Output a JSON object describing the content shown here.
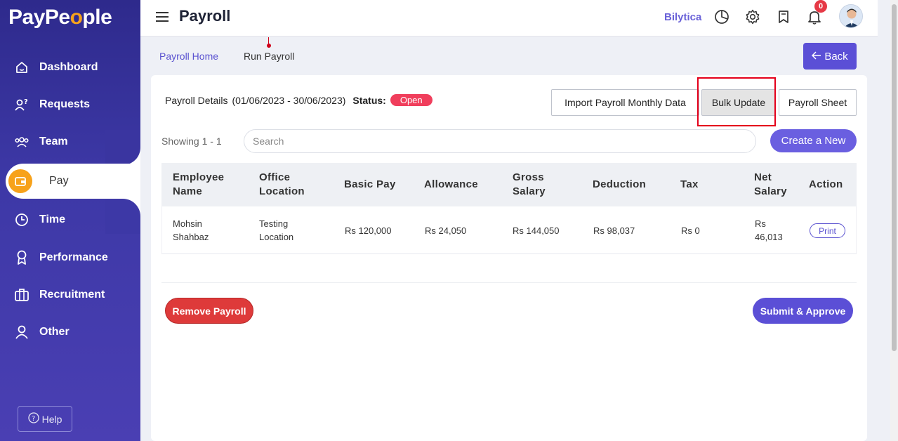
{
  "app": {
    "logo_pre": "PayPe",
    "logo_o": "o",
    "logo_post": "ple"
  },
  "sidebar": {
    "items": [
      {
        "label": "Dashboard",
        "icon": "home-icon"
      },
      {
        "label": "Requests",
        "icon": "requests-icon"
      },
      {
        "label": "Team",
        "icon": "team-icon"
      },
      {
        "label": "Pay",
        "icon": "wallet-icon",
        "active": true
      },
      {
        "label": "Time",
        "icon": "clock-icon"
      },
      {
        "label": "Performance",
        "icon": "award-icon"
      },
      {
        "label": "Recruitment",
        "icon": "briefcase-icon"
      },
      {
        "label": "Other",
        "icon": "user-icon"
      }
    ],
    "help_label": "Help"
  },
  "header": {
    "title": "Payroll",
    "company": "Bilytica",
    "notification_count": "0"
  },
  "breadcrumb": {
    "home": "Payroll Home",
    "current": "Run Payroll"
  },
  "back_label": "Back",
  "details": {
    "label": "Payroll Details",
    "period": "(01/06/2023 - 30/06/2023)",
    "status_label": "Status:",
    "status_value": "Open"
  },
  "actions": {
    "import": "Import Payroll Monthly Data",
    "bulk_update": "Bulk Update",
    "payroll_sheet": "Payroll Sheet",
    "create_new": "Create a New",
    "remove": "Remove Payroll",
    "submit": "Submit & Approve"
  },
  "listing": {
    "showing": "Showing 1 - 1",
    "search_placeholder": "Search"
  },
  "table": {
    "headers": {
      "employee_1": "Employee",
      "employee_2": "Name",
      "office_1": "Office",
      "office_2": "Location",
      "basic": "Basic Pay",
      "allowance": "Allowance",
      "gross_1": "Gross",
      "gross_2": "Salary",
      "deduction": "Deduction",
      "tax": "Tax",
      "net_1": "Net",
      "net_2": "Salary",
      "action": "Action"
    },
    "rows": [
      {
        "name_1": "Mohsin",
        "name_2": "Shahbaz",
        "office_1": "Testing",
        "office_2": "Location",
        "basic": "Rs 120,000",
        "allowance": "Rs 24,050",
        "gross": "Rs 144,050",
        "deduction": "Rs 98,037",
        "tax": "Rs 0",
        "net_1": "Rs",
        "net_2": "46,013",
        "action": "Print"
      }
    ]
  },
  "colors": {
    "primary": "#5b4fd6",
    "accent": "#f7a21b",
    "danger": "#de3a3a",
    "status_open": "#f03e5c"
  }
}
